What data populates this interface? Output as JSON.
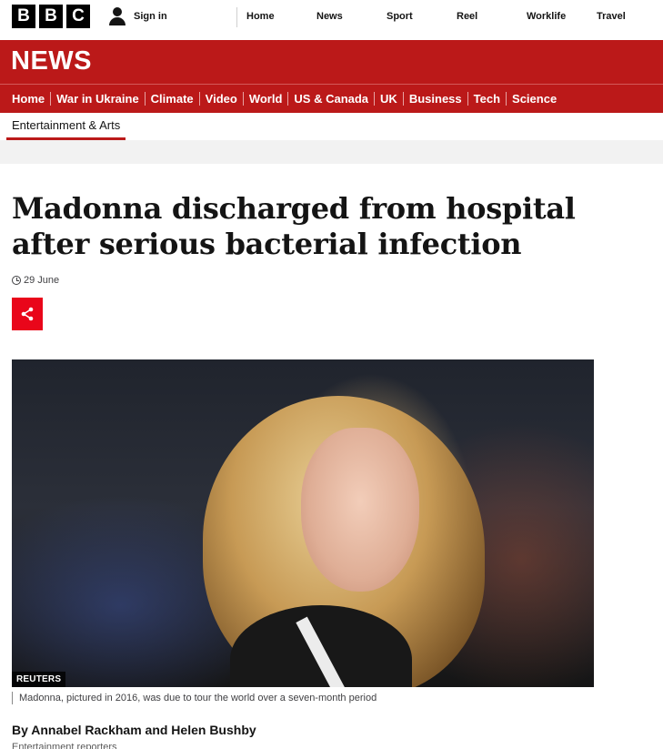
{
  "brand": {
    "logo_letters": [
      "B",
      "B",
      "C"
    ],
    "section_title": "NEWS",
    "accent_color": "#bb1919",
    "share_color": "#e9061a"
  },
  "account": {
    "icon": "person-icon",
    "signin_label": "Sign in"
  },
  "top_nav": [
    "Home",
    "News",
    "Sport",
    "Reel",
    "Worklife",
    "Travel"
  ],
  "section_nav": [
    "Home",
    "War in Ukraine",
    "Climate",
    "Video",
    "World",
    "US & Canada",
    "UK",
    "Business",
    "Tech",
    "Science"
  ],
  "sub_nav": {
    "current": "Entertainment & Arts"
  },
  "article": {
    "headline": "Madonna discharged from hospital after serious bacterial infection",
    "date": "29 June",
    "date_icon": "clock-icon",
    "share_icon": "share-icon",
    "image": {
      "credit": "REUTERS",
      "caption": "Madonna, pictured in 2016, was due to tour the world over a seven-month period"
    },
    "byline": "By Annabel Rackham and Helen Bushby",
    "byline_role": "Entertainment reporters"
  }
}
